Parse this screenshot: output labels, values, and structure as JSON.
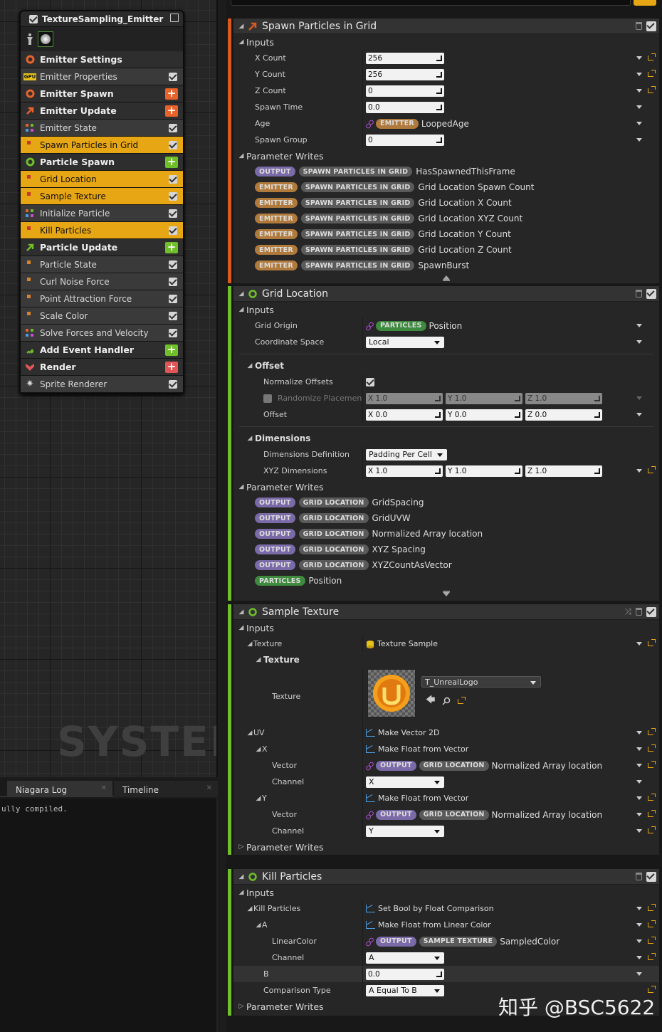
{
  "emitter": {
    "title": "TextureSampling_Emitter",
    "rows": [
      {
        "label": "Emitter Settings"
      },
      {
        "label": "Emitter Properties",
        "badge": "GPU"
      },
      {
        "label": "Emitter Spawn"
      },
      {
        "label": "Emitter Update"
      },
      {
        "label": "Emitter State"
      },
      {
        "label": "Spawn Particles in Grid"
      },
      {
        "label": "Particle Spawn"
      },
      {
        "label": "Grid Location"
      },
      {
        "label": "Sample Texture"
      },
      {
        "label": "Initialize Particle"
      },
      {
        "label": "Kill Particles"
      },
      {
        "label": "Particle Update"
      },
      {
        "label": "Particle State"
      },
      {
        "label": "Curl Noise Force"
      },
      {
        "label": "Point Attraction Force"
      },
      {
        "label": "Scale Color"
      },
      {
        "label": "Solve Forces and Velocity"
      },
      {
        "label": "Add Event Handler"
      },
      {
        "label": "Render"
      },
      {
        "label": "Sprite Renderer"
      }
    ]
  },
  "graph": {
    "watermark": "SYSTEM"
  },
  "log": {
    "tab1": "Niagara Log",
    "tab2": "Timeline",
    "text": "ully compiled."
  },
  "colors": {
    "accent": "#e7a614",
    "output": "#7a6aa8",
    "emitter": "#b07a3c",
    "particles": "#3e8a3e"
  },
  "pills": {
    "output": "OUTPUT",
    "emitter": "EMITTER",
    "particles": "PARTICLES",
    "spig": "SPAWN PARTICLES IN GRID",
    "grid": "GRID LOCATION",
    "sample": "SAMPLE TEXTURE"
  },
  "common": {
    "inputs": "Inputs",
    "param_writes": "Parameter Writes"
  },
  "spawn": {
    "title": "Spawn Particles in Grid",
    "params": [
      {
        "name": "X Count",
        "value": "256"
      },
      {
        "name": "Y Count",
        "value": "256"
      },
      {
        "name": "Z Count",
        "value": "0"
      },
      {
        "name": "Spawn Time",
        "value": "0.0"
      },
      {
        "name": "Age",
        "value": "LoopedAge"
      },
      {
        "name": "Spawn Group",
        "value": "0"
      }
    ],
    "writes": [
      "HasSpawnedThisFrame",
      "Grid Location Spawn Count",
      "Grid Location X Count",
      "Grid Location XYZ Count",
      "Grid Location Y Count",
      "Grid Location Z Count",
      "SpawnBurst"
    ]
  },
  "grid": {
    "title": "Grid Location",
    "grid_origin": "Grid Origin",
    "position": "Position",
    "coord_space": "Coordinate Space",
    "coord_value": "Local",
    "offset_cat": "Offset",
    "normalize": "Normalize Offsets",
    "randomize": "Randomize Placemen",
    "offset": "Offset",
    "rand_vals": [
      "X 1.0",
      "Y 1.0",
      "Z 1.0"
    ],
    "offset_vals": [
      "X 0.0",
      "Y 0.0",
      "Z 0.0"
    ],
    "dims_cat": "Dimensions",
    "dims_def": "Dimensions Definition",
    "dims_def_val": "Padding Per Cell",
    "xyz": "XYZ Dimensions",
    "xyz_vals": [
      "X 1.0",
      "Y 1.0",
      "Z 1.0"
    ],
    "writes": [
      "GridSpacing",
      "GridUVW",
      "Normalized Array location",
      "XYZ Spacing",
      "XYZCountAsVector"
    ],
    "particles_write": "Position"
  },
  "sample": {
    "title": "Sample Texture",
    "texture": "Texture",
    "texture_val": "Texture Sample",
    "texture_cat": "Texture",
    "texture_asset": "T_UnrealLogo",
    "uv": "UV",
    "uv_val": "Make Vector 2D",
    "x": "X",
    "x_val": "Make Float from Vector",
    "vector": "Vector",
    "vec_write": "Normalized Array location",
    "channel": "Channel",
    "x_channel": "X",
    "y": "Y",
    "y_val": "Make Float from Vector",
    "y_channel": "Y"
  },
  "kill": {
    "title": "Kill Particles",
    "kp": "Kill Particles",
    "kp_val": "Set Bool by Float Comparison",
    "a": "A",
    "a_val": "Make Float from Linear Color",
    "lin": "LinearColor",
    "lin_write": "SampledColor",
    "channel": "Channel",
    "channel_val": "A",
    "b": "B",
    "b_val": "0.0",
    "cmp": "Comparison Type",
    "cmp_val": "A Equal To B"
  },
  "watermark": "知乎 @BSC5622"
}
